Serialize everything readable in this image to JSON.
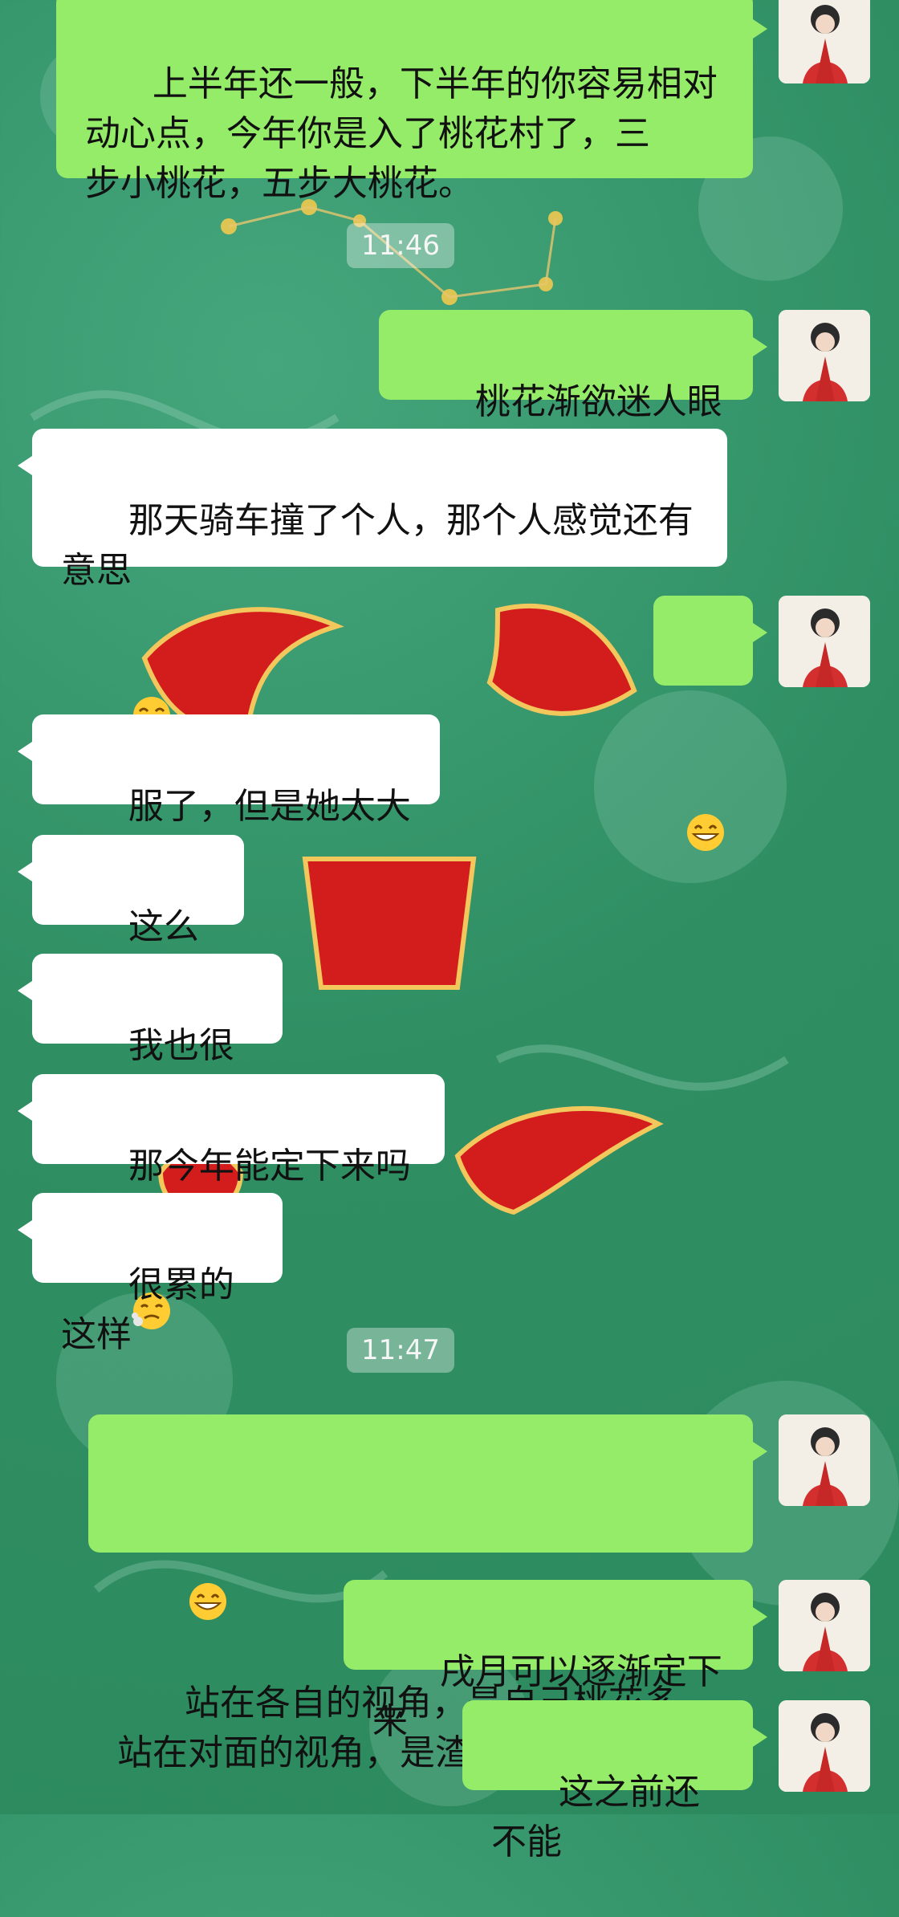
{
  "messages": [
    {
      "text": "上半年还一般，下半年的你容易相对\n动心点，今年你是入了桃花村了，三\n步小桃花，五步大桃花。"
    },
    {
      "time": "11:46"
    },
    {
      "text": "桃花渐欲迷人眼",
      "emoji": "grinning-face-icon"
    },
    {
      "text": "那天骑车撞了个人，那个人感觉还有\n意思",
      "emoji": "crying-laugh-icon"
    },
    {
      "emoji": "grinning-face-icon"
    },
    {
      "text": "服了，但是她太大了"
    },
    {
      "text": "这么一想"
    },
    {
      "text": "我也很渣啊"
    },
    {
      "text": "那今年能定下来吗",
      "emoji": "sighing-face-icon"
    },
    {
      "text": "很累的这样"
    },
    {
      "time": "11:47"
    },
    {
      "text": "站在各自的视角，是自己桃花多，\n站在对面的视角，是渣。",
      "emoji": "grinning-face-icon"
    },
    {
      "text": "戌月可以逐渐定下来"
    },
    {
      "text": "这之前还不能"
    }
  ],
  "colors": {
    "background": "#2f8f63",
    "outgoing_bubble": "#95ec69",
    "incoming_bubble": "#ffffff"
  }
}
